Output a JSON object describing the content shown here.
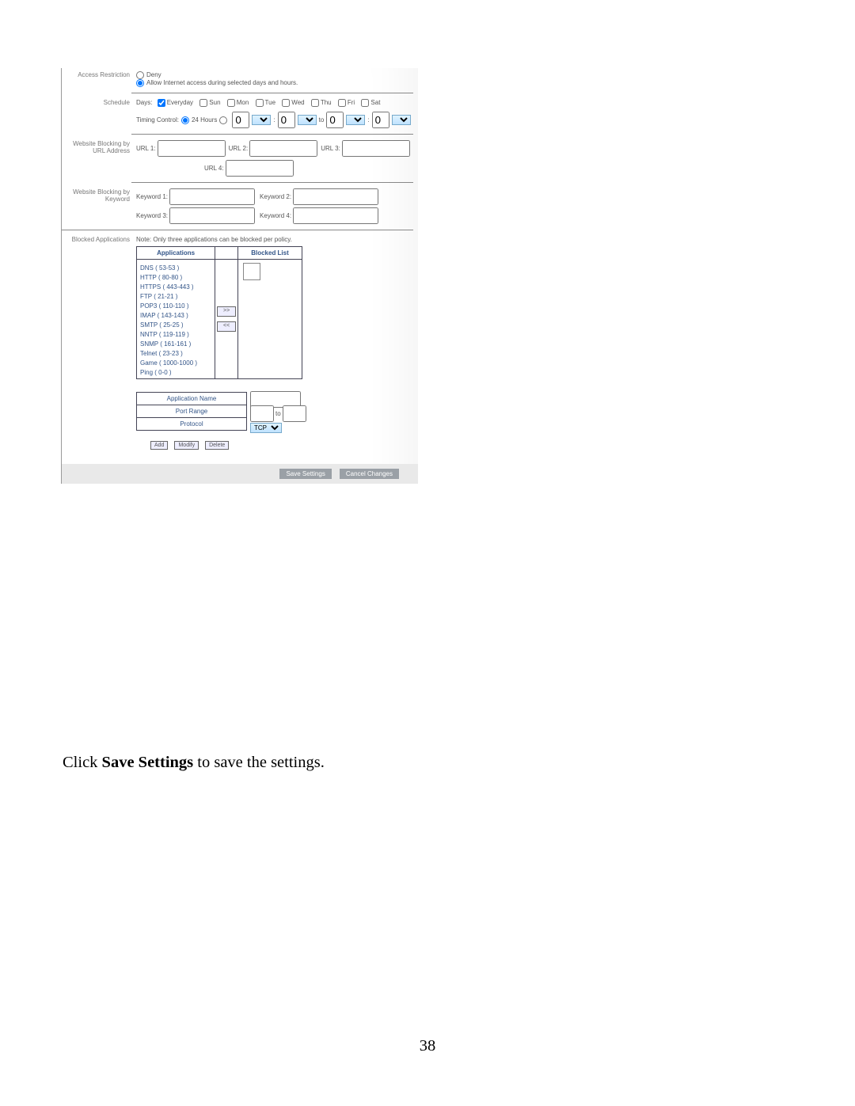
{
  "sections": {
    "access_restriction": "Access Restriction",
    "schedule": "Schedule",
    "website_by_url": "Website Blocking by URL Address",
    "website_by_keyword": "Website Blocking by Keyword",
    "blocked_apps": "Blocked Applications"
  },
  "access": {
    "deny_label": "Deny",
    "allow_label": "Allow  Internet access during selected days and hours."
  },
  "schedule": {
    "days_label": "Days:",
    "days": [
      "Everyday",
      "Sun",
      "Mon",
      "Tue",
      "Wed",
      "Thu",
      "Fri",
      "Sat"
    ],
    "everyday_checked": true,
    "timing_label": "Timing Control:",
    "opt_24": "24 Hours",
    "time_sep1": ":",
    "time_sep2": ":",
    "to": "to",
    "hour1": "0",
    "min1": "0",
    "hour2": "0",
    "min2": "0"
  },
  "url": {
    "u1": "URL 1:",
    "u2": "URL 2:",
    "u3": "URL 3:",
    "u4": "URL 4:"
  },
  "keyword": {
    "k1": "Keyword 1:",
    "k2": "Keyword 2:",
    "k3": "Keyword 3:",
    "k4": "Keyword 4:"
  },
  "apps": {
    "note": "Note: Only three applications can be blocked per policy.",
    "hdr_apps": "Applications",
    "hdr_blocked": "Blocked List",
    "list": [
      "DNS ( 53-53 )",
      "HTTP ( 80-80 )",
      "HTTPS ( 443-443 )",
      "FTP ( 21-21 )",
      "POP3 ( 110-110 )",
      "IMAP ( 143-143 )",
      "SMTP ( 25-25 )",
      "NNTP ( 119-119 )",
      "SNMP ( 161-161 )",
      "Telnet ( 23-23 )",
      "Game ( 1000-1000 )",
      "Ping ( 0-0 )"
    ],
    "btn_add": ">>",
    "btn_remove": "<<"
  },
  "form": {
    "app_name": "Application Name",
    "port_range": "Port Range",
    "port_to": "to",
    "protocol": "Protocol",
    "protocol_value": "TCP"
  },
  "form_buttons": {
    "add": "Add",
    "modify": "Modify",
    "delete": "Delete"
  },
  "footer": {
    "save": "Save Settings",
    "cancel": "Cancel Changes"
  },
  "doc": {
    "caption_prefix": "Click ",
    "caption_bold": "Save Settings",
    "caption_suffix": " to save the settings.",
    "page_num": "38"
  }
}
